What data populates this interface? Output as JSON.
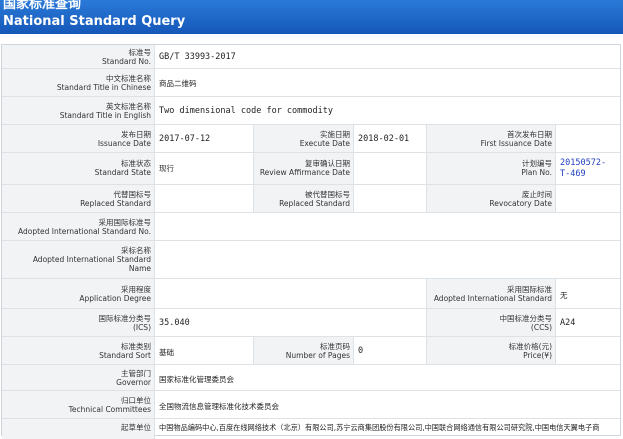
{
  "header": {
    "title_cn": "国家标准查询",
    "title_en": "National Standard Query"
  },
  "fields": {
    "std_no": {
      "cn": "标准号",
      "en": "Standard No.",
      "value": "GB/T 33993-2017"
    },
    "title_cn": {
      "cn": "中文标准名称",
      "en": "Standard Title in Chinese",
      "value": "商品二维码"
    },
    "title_en": {
      "cn": "英文标准名称",
      "en": "Standard Title in English",
      "value": "Two dimensional code for commodity"
    },
    "issue": {
      "cn": "发布日期",
      "en": "Issuance Date",
      "value": "2017-07-12"
    },
    "execute": {
      "cn": "实施日期",
      "en": "Execute Date",
      "value": "2018-02-01"
    },
    "first_issue": {
      "cn": "首次发布日期",
      "en": "First Issuance Date",
      "value": ""
    },
    "state": {
      "cn": "标准状态",
      "en": "Standard State",
      "value": "现行"
    },
    "review": {
      "cn": "复审确认日期",
      "en": "Review Affirmance Date",
      "value": ""
    },
    "plan": {
      "cn": "计划编号",
      "en": "Plan No.",
      "value_l1": "20150572-",
      "value_l2": "T-469"
    },
    "replaced_std": {
      "cn": "代替国标号",
      "en": "Replaced Standard",
      "value": ""
    },
    "replaced_by": {
      "cn": "被代替国标号",
      "en": "Replaced Standard",
      "value": ""
    },
    "revocatory": {
      "cn": "废止时间",
      "en": "Revocatory Date",
      "value": ""
    },
    "adopted_no": {
      "cn": "采用国际标准号",
      "en": "Adopted International Standard No.",
      "value": ""
    },
    "adopted_name": {
      "cn": "采标名称",
      "en_l1": "Adopted International Standard",
      "en_l2": "Name",
      "value": ""
    },
    "app_degree": {
      "cn": "采用程度",
      "en": "Application Degree",
      "value": ""
    },
    "adopted_intl": {
      "cn": "采用国际标准",
      "en": "Adopted International Standard",
      "value": "无"
    },
    "ics": {
      "cn": "国际标准分类号",
      "en": "(ICS)",
      "value": "35.040"
    },
    "ccs": {
      "cn": "中国标准分类号",
      "en": "(CCS)",
      "value": "A24"
    },
    "sort": {
      "cn": "标准类别",
      "en": "Standard Sort",
      "value": "基础"
    },
    "pages": {
      "cn": "标准页码",
      "en": "Number of Pages",
      "value": "0"
    },
    "price": {
      "cn": "标准价格(元)",
      "en": "Price(¥)",
      "value": ""
    },
    "governor": {
      "cn": "主管部门",
      "en": "Governor",
      "value": "国家标准化管理委员会"
    },
    "committee": {
      "cn": "归口单位",
      "en": "Technical Committees",
      "value": "全国物流信息管理标准化技术委员会"
    },
    "drafter": {
      "cn": "起草单位",
      "value": "中国物品编码中心,百度在线网络技术（北京）有限公司,苏宁云商集团股份有限公司,中国联合网络通信有限公司研究院,中国电信天翼电子商"
    }
  }
}
